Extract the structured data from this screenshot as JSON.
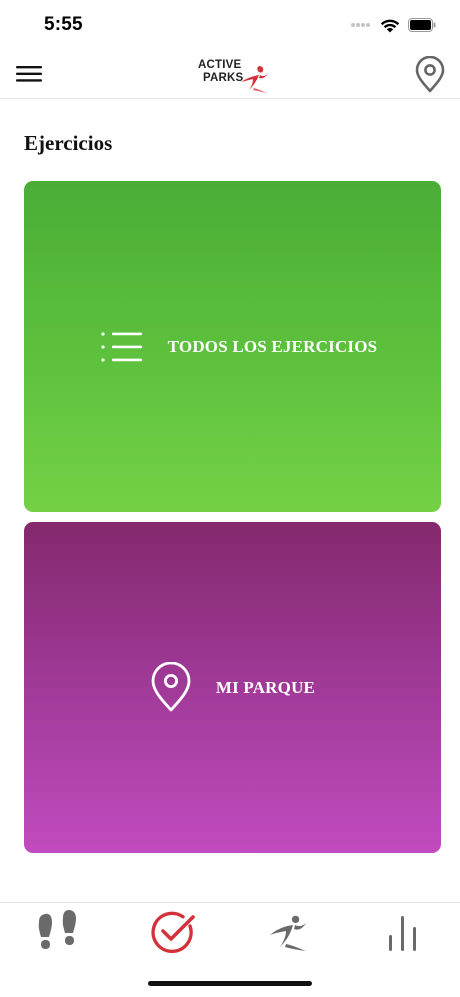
{
  "status_bar": {
    "time": "5:55"
  },
  "nav": {
    "logo_line1": "ACTIVE",
    "logo_line2": "PARKS",
    "menu_icon": "hamburger-menu-icon",
    "location_icon": "location-pin-icon"
  },
  "page": {
    "title": "Ejercicios"
  },
  "cards": {
    "exercises": {
      "label": "TODOS LOS EJERCICIOS",
      "icon": "list-icon",
      "gradient": [
        "#4aad36",
        "#74d146"
      ]
    },
    "park": {
      "label": "MI PARQUE",
      "icon": "location-pin-icon",
      "gradient": [
        "#84296d",
        "#c14bbf"
      ]
    }
  },
  "tab_bar": {
    "tabs": [
      {
        "icon": "footprints-icon",
        "active": false
      },
      {
        "icon": "check-circle-icon",
        "active": true
      },
      {
        "icon": "runner-icon",
        "active": false
      },
      {
        "icon": "bar-chart-icon",
        "active": false
      }
    ],
    "active_color": "#d2323a",
    "inactive_color": "#6a6a6a"
  }
}
